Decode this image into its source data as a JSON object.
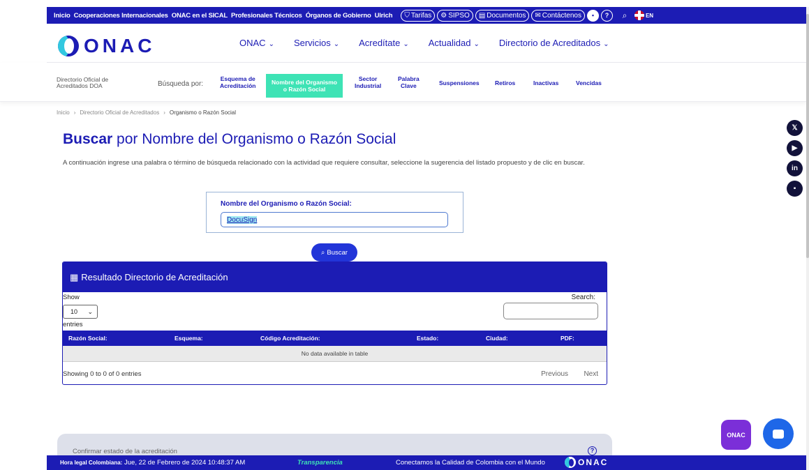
{
  "topbar": {
    "links": [
      "Inicio",
      "Cooperaciones Internacionales",
      "ONAC en el SICAL",
      "Profesionales Técnicos",
      "Órganos de Gobierno",
      "Ulrich"
    ],
    "pills": [
      "Tarifas",
      "SIPSO",
      "Documentos",
      "Contáctenos"
    ],
    "lang": "EN"
  },
  "logo": {
    "text": "ONAC"
  },
  "nav": {
    "items": [
      "ONAC",
      "Servicios",
      "Acredítate",
      "Actualidad",
      "Directorio de Acreditados"
    ]
  },
  "subnav": {
    "doa": "Directorio Oficial de Acreditados DOA",
    "busqueda": "Búsqueda por:",
    "items": [
      {
        "line1": "Esquema de",
        "line2": "Acreditación"
      },
      {
        "line1": "Nombre del Organismo",
        "line2": "o Razón Social"
      },
      {
        "line1": "Sector",
        "line2": "Industrial"
      },
      {
        "line1": "Palabra",
        "line2": "Clave"
      },
      {
        "line1": "Suspensiones",
        "line2": ""
      },
      {
        "line1": "Retiros",
        "line2": ""
      },
      {
        "line1": "Inactivas",
        "line2": ""
      },
      {
        "line1": "Vencidas",
        "line2": ""
      }
    ]
  },
  "breadcrumb": {
    "home": "Inicio",
    "directory": "Directorio Oficial de Acreditados",
    "current": "Organismo o Razón Social"
  },
  "page": {
    "title_bold": "Buscar",
    "title_rest": " por Nombre del Organismo o Razón Social",
    "intro": "A continuación ingrese una palabra o término de búsqueda relacionado con la actividad que requiere consultar, seleccione la sugerencia del listado propuesto y de clic en buscar."
  },
  "search": {
    "label": "Nombre del Organismo o Razón Social:",
    "value": "DocuSign",
    "button": "Buscar"
  },
  "results": {
    "title": "Resultado Directorio de Acreditación",
    "show": "Show",
    "entries_value": "10",
    "entries": "entries",
    "search_label": "Search:",
    "columns": [
      "Razón Social:",
      "Esquema:",
      "Código Acreditación:",
      "Estado:",
      "Ciudad:",
      "PDF:"
    ],
    "empty": "No data available in table",
    "info": "Showing 0 to 0 of 0 entries",
    "previous": "Previous",
    "next": "Next"
  },
  "bottom": {
    "text": "Confirmar estado de la acreditación",
    "help": "?"
  },
  "footer": {
    "time_label": "Hora legal Colombiana:",
    "time_value": " Jue, 22 de Febrero de 2024 10:48:37 AM",
    "transparency": "Transparencia",
    "tagline": "Conectamos la Calidad de Colombia con el Mundo",
    "logo_text": "ONAC"
  },
  "social": [
    "x",
    "youtube",
    "linkedin",
    "onac-app"
  ],
  "chat": {
    "onac_label": "ONAC"
  }
}
